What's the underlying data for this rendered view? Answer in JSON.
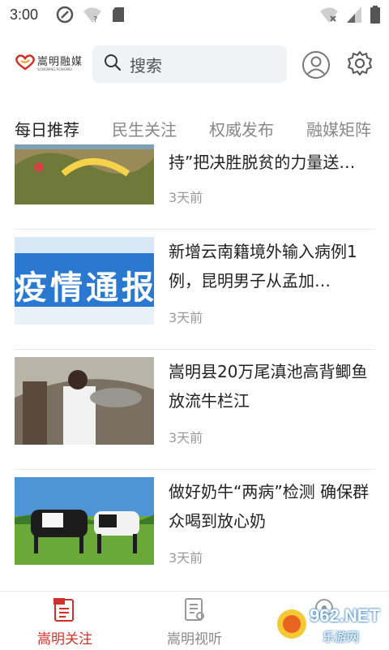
{
  "status_bar": {
    "time": "3:00",
    "icons_left": [
      "at-sign-icon",
      "wifi-unknown-icon",
      "sd-card-icon"
    ],
    "icons_right": [
      "wifi-off-icon",
      "signal-icon",
      "battery-icon"
    ]
  },
  "header": {
    "logo_text": "嵩明融媒",
    "logo_subtext": "SONGMING RONGMEI",
    "search_placeholder": "搜索",
    "icons": [
      "user-icon",
      "gear-icon"
    ]
  },
  "tabs": [
    {
      "label": "每日推荐",
      "active": true
    },
    {
      "label": "民生关注",
      "active": false
    },
    {
      "label": "权威发布",
      "active": false
    },
    {
      "label": "融媒矩阵",
      "active": false
    }
  ],
  "news": [
    {
      "title": "持”把决胜脱贫的力量送…",
      "time": "3天前"
    },
    {
      "title": "新增云南籍境外输入病例1例，昆明男子从孟加…",
      "time": "3天前",
      "thumb_text": "疫情通报"
    },
    {
      "title": "嵩明县20万尾滇池高背鲫鱼放流牛栏江",
      "time": "3天前"
    },
    {
      "title": "做好奶牛“两病”检测 确保群众喝到放心奶",
      "time": "3天前"
    }
  ],
  "bottom_nav": [
    {
      "label": "嵩明关注",
      "active": true,
      "icon": "newspaper-icon"
    },
    {
      "label": "嵩明视听",
      "active": false,
      "icon": "document-icon"
    },
    {
      "label": "",
      "active": false,
      "icon": "location-icon"
    }
  ],
  "watermark": {
    "text": "962.NET",
    "subtext": "乐游网"
  },
  "colors": {
    "accent": "#d0322a",
    "muted": "#888888",
    "search_bg": "#f1f2f4"
  }
}
